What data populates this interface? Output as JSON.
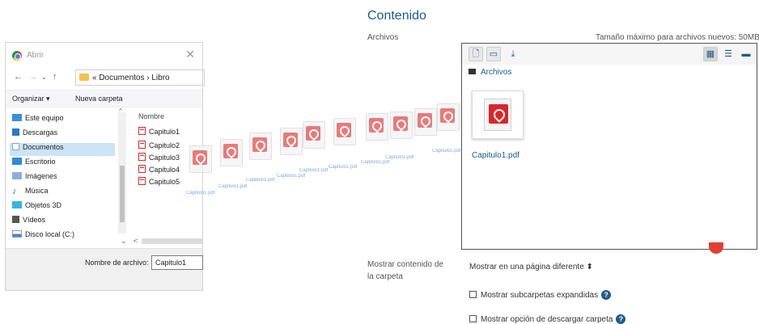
{
  "dialog": {
    "title": "Abrir",
    "breadcrumb": "« Documentos › Libro",
    "toolbar": {
      "organize": "Organizar ▾",
      "new_folder": "Nueva carpeta"
    },
    "nav_items": [
      "Este equipo",
      "Descargas",
      "Documentos",
      "Escritorio",
      "Imágenes",
      "Música",
      "Objetos 3D",
      "Vídeos",
      "Disco local (C:)"
    ],
    "column_header": "Nombre",
    "files": [
      "Capitulo1",
      "Capitulo2",
      "Capitulo3",
      "Capitulo4",
      "Capitulo5"
    ],
    "filename_label": "Nombre de archivo:",
    "filename_value": "Capitulo1"
  },
  "drag": {
    "labels": [
      "Capitulo1.pdf",
      "Capitulo1.pdf",
      "Capitulo1.pdf",
      "Capitulo1.pdf",
      "Capitulo1.pdf",
      "Capitulo1.pdf",
      "Capitulo1.pdf",
      "Capitulo1.pdf",
      "Capitulo1.pdf"
    ]
  },
  "content": {
    "section_title": "Contenido",
    "files_label": "Archivos",
    "max_size": "Tamaño máximo para archivos nuevos: 50MB",
    "path": "Archivos",
    "file_name": "Capitulo1.pdf",
    "display_label": "Mostrar contenido de la carpeta",
    "display_value": "Mostrar en una página diferente ⬍",
    "chk_subfolders": "Mostrar subcarpetas expandidas",
    "chk_download": "Mostrar opción de descargar carpeta"
  }
}
